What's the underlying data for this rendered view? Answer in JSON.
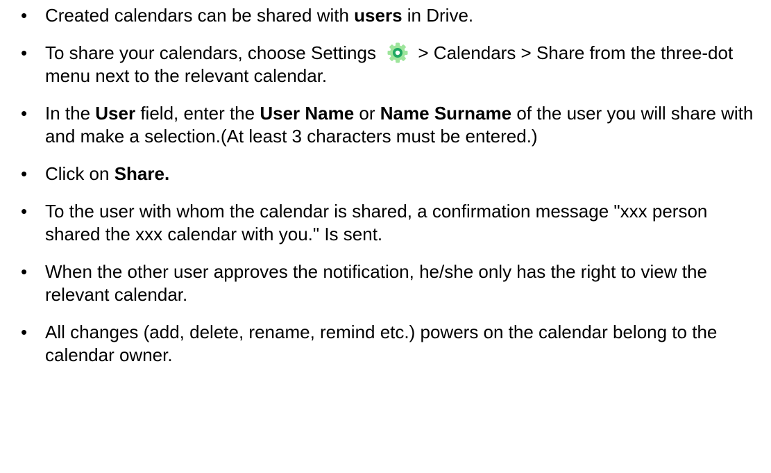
{
  "colors": {
    "gear_outer": "#9ee59c",
    "gear_inner": "#1fa862",
    "gear_center": "#ffffff",
    "text": "#000000"
  },
  "icons": {
    "settings": "settings-gear-icon"
  },
  "bullets": [
    {
      "t1": "Created calendars can be shared with ",
      "b1": "users",
      "t2": " in Drive."
    },
    {
      "t1": "To share your calendars, choose Settings ",
      "t2": " > Calendars > Share from the three-dot menu next to the relevant calendar."
    },
    {
      "t1": "In the ",
      "b1": "User",
      "t2": " field, enter the ",
      "b2": "User Name",
      "t3": " or ",
      "b3": "Name Surname",
      "t4": " of the user you will share with and make a selection.(At least 3 characters must be entered.)"
    },
    {
      "t1": "Click on ",
      "b1": "Share."
    },
    {
      "t1": "To the user with whom the calendar is shared, a confirmation message \"xxx person shared the xxx calendar with you.\" Is sent."
    },
    {
      "t1": "When the other user approves the notification, he/she only has the right to view the relevant calendar."
    },
    {
      "t1": "All changes (add, delete, rename, remind etc.) powers on the calendar belong to the calendar owner."
    }
  ]
}
